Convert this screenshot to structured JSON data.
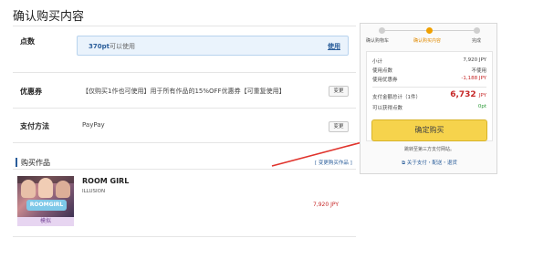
{
  "page": {
    "title": "确认购买内容"
  },
  "points": {
    "label": "点数",
    "value": "370pt",
    "value_suffix": "可以使用",
    "use_button": "使用"
  },
  "coupon": {
    "label": "优惠券",
    "text": "【仅购买1作也可使用】用于所有作品的15%OFF优惠券【可重复使用】",
    "change_button": "变更"
  },
  "payment": {
    "label": "支付方法",
    "method": "PayPay",
    "change_button": "变更"
  },
  "works": {
    "label": "购买作品",
    "change_link": "[ 变更购买作品 ]",
    "items": [
      {
        "title": "ROOM GIRL",
        "brand": "ILLUSION",
        "price": "7,920 JPY",
        "thumb_logo": "ROOMGIRL",
        "tag": "模拟"
      }
    ]
  },
  "steps": [
    {
      "label": "确认购物车",
      "active": false
    },
    {
      "label": "确认购买内容",
      "active": true
    },
    {
      "label": "完成",
      "active": false
    }
  ],
  "summary": {
    "rows": [
      {
        "label": "小计",
        "value": "7,920 JPY"
      },
      {
        "label": "使用点数",
        "value": "不使用"
      },
      {
        "label": "使用优惠券",
        "value": "-1,188 JPY"
      }
    ],
    "total_label": "支付金额总计（1件）",
    "total_value": "6,732",
    "total_unit": "JPY",
    "earn_label": "可以获得点数",
    "earn_value": "0pt"
  },
  "confirm_button": "确定购买",
  "redirect_note": "跳转至第三方支付网站。",
  "help_link": "关于支付・配送・退货",
  "colors": {
    "accent": "#f6d34c",
    "link": "#2a5d9a",
    "price": "#c62828"
  }
}
